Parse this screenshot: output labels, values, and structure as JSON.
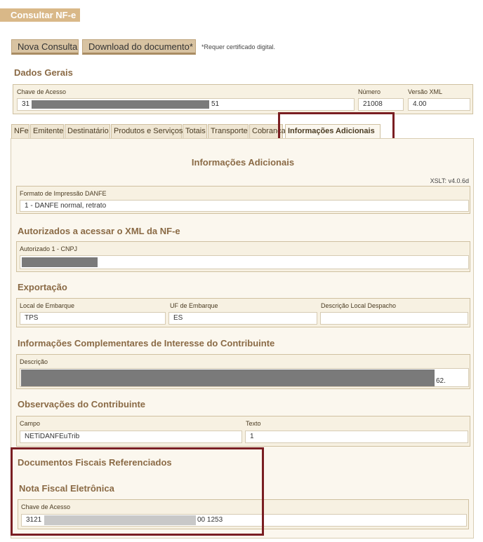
{
  "header": {
    "title": "Consultar NF-e"
  },
  "toolbar": {
    "new_query_label": "Nova Consulta",
    "download_label": "Download do documento*",
    "note": "*Requer certificado digital."
  },
  "general": {
    "title": "Dados Gerais",
    "access_key": {
      "label": "Chave de Acesso",
      "prefix": "31",
      "suffix": "51"
    },
    "number": {
      "label": "Número",
      "value": "21008"
    },
    "xml_version": {
      "label": "Versão XML",
      "value": "4.00"
    }
  },
  "tabs": [
    {
      "label": "NFe"
    },
    {
      "label": "Emitente"
    },
    {
      "label": "Destinatário"
    },
    {
      "label": "Produtos e Serviços"
    },
    {
      "label": "Totais"
    },
    {
      "label": "Transporte"
    },
    {
      "label": "Cobrança"
    },
    {
      "label": "Informações Adicionais"
    }
  ],
  "panel": {
    "title": "Informações Adicionais",
    "xslt": "XSLT: v4.0.6d",
    "print_format": {
      "label": "Formato de Impressão DANFE",
      "value": "1 - DANFE normal, retrato"
    },
    "authorized": {
      "title": "Autorizados a acessar o XML da NF-e",
      "field_label": "Autorizado 1 - CNPJ"
    },
    "export": {
      "title": "Exportação",
      "loading_place": {
        "label": "Local de Embarque",
        "value": "TPS"
      },
      "loading_uf": {
        "label": "UF de Embarque",
        "value": "ES"
      },
      "dispatch_desc": {
        "label": "Descrição Local Despacho",
        "value": ""
      }
    },
    "complementary": {
      "title": "Informações Complementares de Interesse do Contribuinte",
      "desc_label": "Descrição",
      "desc_suffix": "62."
    },
    "observations": {
      "title": "Observações do Contribuinte",
      "field": {
        "label": "Campo",
        "value": "NETiDANFEuTrib"
      },
      "text": {
        "label": "Texto",
        "value": "1"
      }
    },
    "referenced": {
      "title": "Documentos Fiscais Referenciados",
      "subtitle": "Nota Fiscal Eletrônica",
      "access_key": {
        "label": "Chave de Acesso",
        "prefix": "3121",
        "suffix": "00 1253"
      }
    }
  },
  "colors": {
    "accent": "#d9b888",
    "section_title": "#8a6a45",
    "highlight": "#7a1e22",
    "panel_bg": "#fbf7ee"
  }
}
